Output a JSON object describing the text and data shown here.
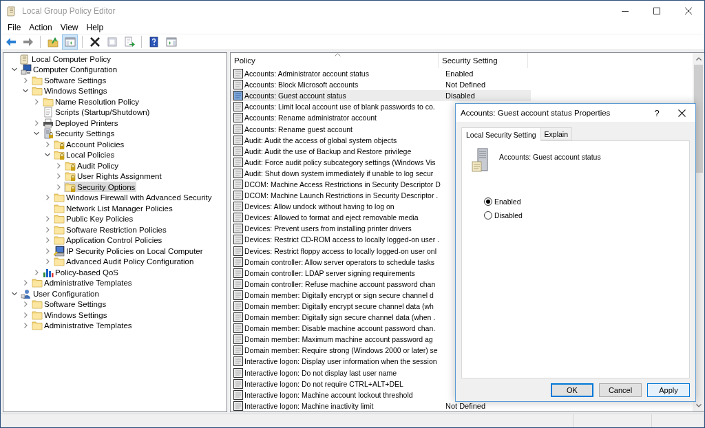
{
  "window": {
    "title": "Local Group Policy Editor"
  },
  "menu": [
    "File",
    "Action",
    "View",
    "Help"
  ],
  "toolbar": {
    "groups": [
      [
        {
          "kind": "back",
          "pressed": false
        },
        {
          "kind": "forward",
          "pressed": false
        }
      ],
      [
        {
          "kind": "up",
          "pressed": false
        },
        {
          "kind": "tree-toggle",
          "pressed": true
        }
      ],
      [
        {
          "kind": "delete",
          "pressed": false
        },
        {
          "kind": "properties",
          "pressed": false
        },
        {
          "kind": "export",
          "pressed": false
        }
      ],
      [
        {
          "kind": "help",
          "pressed": false
        },
        {
          "kind": "pane",
          "pressed": false
        }
      ]
    ]
  },
  "tree": {
    "root": {
      "label": "Local Computer Policy",
      "kind": "scroll",
      "selected": false
    },
    "items": [
      {
        "label": "Computer Configuration",
        "kind": "computer",
        "expanded": true,
        "selected": false,
        "children": [
          {
            "label": "Software Settings",
            "kind": "folder",
            "expanded": false,
            "selected": false
          },
          {
            "label": "Windows Settings",
            "kind": "folder",
            "expanded": true,
            "selected": false,
            "children": [
              {
                "label": "Name Resolution Policy",
                "kind": "folder",
                "expanded": false,
                "selected": false
              },
              {
                "label": "Scripts (Startup/Shutdown)",
                "kind": "script",
                "selected": false
              },
              {
                "label": "Deployed Printers",
                "kind": "printer",
                "expanded": false,
                "selected": false
              },
              {
                "label": "Security Settings",
                "kind": "server",
                "expanded": true,
                "selected": false,
                "children": [
                  {
                    "label": "Account Policies",
                    "kind": "locked-folder",
                    "expanded": false,
                    "selected": false
                  },
                  {
                    "label": "Local Policies",
                    "kind": "locked-folder",
                    "expanded": true,
                    "selected": false,
                    "children": [
                      {
                        "label": "Audit Policy",
                        "kind": "locked-folder",
                        "expanded": false,
                        "selected": false
                      },
                      {
                        "label": "User Rights Assignment",
                        "kind": "locked-folder",
                        "expanded": false,
                        "selected": false
                      },
                      {
                        "label": "Security Options",
                        "kind": "locked-folder",
                        "expanded": false,
                        "selected": true
                      }
                    ]
                  },
                  {
                    "label": "Windows Firewall with Advanced Security",
                    "kind": "folder",
                    "expanded": false,
                    "selected": false
                  },
                  {
                    "label": "Network List Manager Policies",
                    "kind": "folder",
                    "selected": false
                  },
                  {
                    "label": "Public Key Policies",
                    "kind": "folder",
                    "expanded": false,
                    "selected": false
                  },
                  {
                    "label": "Software Restriction Policies",
                    "kind": "folder",
                    "expanded": false,
                    "selected": false
                  },
                  {
                    "label": "Application Control Policies",
                    "kind": "folder",
                    "expanded": false,
                    "selected": false
                  },
                  {
                    "label": "IP Security Policies on Local Computer",
                    "kind": "network",
                    "expanded": false,
                    "selected": false
                  },
                  {
                    "label": "Advanced Audit Policy Configuration",
                    "kind": "folder",
                    "expanded": false,
                    "selected": false
                  }
                ]
              },
              {
                "label": "Policy-based QoS",
                "kind": "chart",
                "expanded": false,
                "selected": false
              }
            ]
          },
          {
            "label": "Administrative Templates",
            "kind": "folder",
            "expanded": false,
            "selected": false
          }
        ]
      },
      {
        "label": "User Configuration",
        "kind": "user",
        "expanded": true,
        "selected": false,
        "children": [
          {
            "label": "Software Settings",
            "kind": "folder",
            "expanded": false,
            "selected": false
          },
          {
            "label": "Windows Settings",
            "kind": "folder",
            "expanded": false,
            "selected": false
          },
          {
            "label": "Administrative Templates",
            "kind": "folder",
            "expanded": false,
            "selected": false
          }
        ]
      }
    ]
  },
  "policy_list": {
    "columns": [
      {
        "label": "Policy",
        "sorted": true
      },
      {
        "label": "Security Setting",
        "sorted": false
      }
    ],
    "rows": [
      {
        "policy": "Accounts: Administrator account status",
        "setting": "Enabled",
        "selected": false
      },
      {
        "policy": "Accounts: Block Microsoft accounts",
        "setting": "Not Defined",
        "selected": false
      },
      {
        "policy": "Accounts: Guest account status",
        "setting": "Disabled",
        "selected": true
      },
      {
        "policy": "Accounts: Limit local account use of blank passwords to co.",
        "selected": false
      },
      {
        "policy": "Accounts: Rename administrator account",
        "selected": false
      },
      {
        "policy": "Accounts: Rename guest account",
        "selected": false
      },
      {
        "policy": "Audit: Audit the access of global system objects",
        "selected": false
      },
      {
        "policy": "Audit: Audit the use of Backup and Restore privilege",
        "selected": false
      },
      {
        "policy": "Audit: Force audit policy subcategory settings (Windows Vis",
        "selected": false
      },
      {
        "policy": "Audit: Shut down system immediately if unable to log secur",
        "selected": false
      },
      {
        "policy": "DCOM: Machine Access Restrictions in Security Descriptor D",
        "selected": false
      },
      {
        "policy": "DCOM: Machine Launch Restrictions in Security Descriptor .",
        "selected": false
      },
      {
        "policy": "Devices: Allow undock without having to log on",
        "selected": false
      },
      {
        "policy": "Devices: Allowed to format and eject removable media",
        "selected": false
      },
      {
        "policy": "Devices: Prevent users from installing printer drivers",
        "selected": false
      },
      {
        "policy": "Devices: Restrict CD-ROM access to locally logged-on user .",
        "selected": false
      },
      {
        "policy": "Devices: Restrict floppy access to locally logged-on user onl",
        "selected": false
      },
      {
        "policy": "Domain controller: Allow server operators to schedule tasks",
        "selected": false
      },
      {
        "policy": "Domain controller: LDAP server signing requirements",
        "selected": false
      },
      {
        "policy": "Domain controller: Refuse machine account password chan",
        "selected": false
      },
      {
        "policy": "Domain member: Digitally encrypt or sign secure channel d",
        "selected": false
      },
      {
        "policy": "Domain member: Digitally encrypt secure channel data (wh",
        "selected": false
      },
      {
        "policy": "Domain member: Digitally sign secure channel data (when .",
        "selected": false
      },
      {
        "policy": "Domain member: Disable machine account password chan.",
        "selected": false
      },
      {
        "policy": "Domain member: Maximum machine account password ag",
        "selected": false
      },
      {
        "policy": "Domain member: Require strong (Windows 2000 or later) se",
        "selected": false
      },
      {
        "policy": "Interactive logon: Display user information when the session",
        "selected": false
      },
      {
        "policy": "Interactive logon: Do not display last user name",
        "selected": false
      },
      {
        "policy": "Interactive logon: Do not require CTRL+ALT+DEL",
        "selected": false
      },
      {
        "policy": "Interactive logon: Machine account lockout threshold",
        "selected": false
      },
      {
        "policy": "Interactive logon: Machine inactivity limit",
        "setting": "Not Defined",
        "selected": false
      }
    ]
  },
  "dialog": {
    "title": "Accounts: Guest account status Properties",
    "help": "?",
    "tabs": [
      {
        "label": "Local Security Setting",
        "selected": true
      },
      {
        "label": "Explain",
        "selected": false
      }
    ],
    "policy_name": "Accounts: Guest account status",
    "options": [
      {
        "label": "Enabled",
        "selected": true
      },
      {
        "label": "Disabled",
        "selected": false
      }
    ],
    "buttons": [
      {
        "label": "OK",
        "kind": "default"
      },
      {
        "label": "Cancel",
        "kind": "normal"
      },
      {
        "label": "Apply",
        "kind": "focused"
      }
    ]
  }
}
